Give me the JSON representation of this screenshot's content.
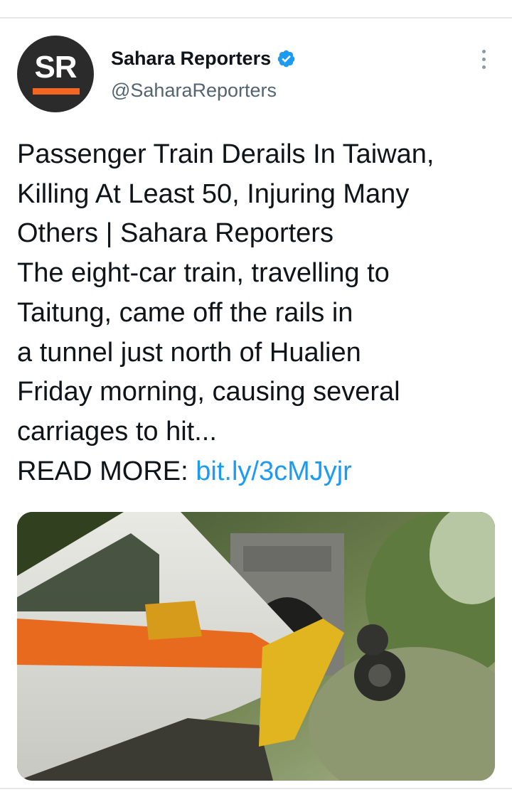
{
  "tweet": {
    "author_name": "Sahara Reporters",
    "handle": "@SaharaReporters",
    "avatar_text": "SR",
    "verified": true,
    "text_lines": [
      "Passenger Train Derails In Taiwan,",
      "Killing At Least 50, Injuring Many",
      "Others | Sahara Reporters",
      "The eight-car train, travelling to",
      "Taitung, came off the rails in",
      "a tunnel just north of Hualien",
      "Friday morning, causing several",
      "carriages to hit..."
    ],
    "read_more_label": "READ MORE: ",
    "link_text": "bit.ly/3cMJyjr"
  },
  "colors": {
    "link": "#1d9bf0",
    "verified": "#1d9bf0",
    "brand_orange": "#f26522",
    "avatar_bg": "#2b2b2b"
  },
  "icons": {
    "verified": "verified-badge-icon",
    "more": "more-options-icon"
  }
}
